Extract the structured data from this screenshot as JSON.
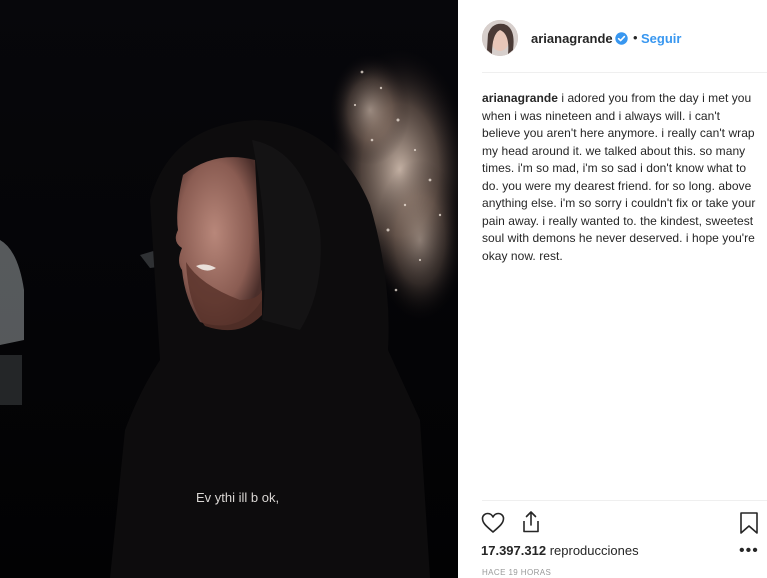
{
  "post": {
    "username": "arianagrande",
    "follow_label": "Seguir",
    "separator": "•",
    "caption_user": "arianagrande",
    "caption_text": "i adored you from the day i met you when i was nineteen and i always will. i can't believe you aren't here anymore. i really can't wrap my head around it. we talked about this. so many times. i'm so mad, i'm so sad i don't know what to do. you were my dearest friend. for so long. above anything else. i'm so sorry i couldn't fix or take your pain away. i really wanted to. the kindest, sweetest soul with demons he never deserved. i hope you're okay now. rest.",
    "views_count": "17.397.312",
    "views_label": "reproducciones",
    "time_ago": "HACE 19 HORAS",
    "more_label": "•••",
    "shirt_text": "Ev ythi ill b ok,"
  },
  "colors": {
    "link_blue": "#3897f0",
    "verified_blue": "#3897f0",
    "text_dark": "#262626",
    "muted": "#999999"
  },
  "icons": [
    "verified-badge-icon",
    "heart-icon",
    "share-icon",
    "bookmark-icon",
    "more-icon"
  ]
}
